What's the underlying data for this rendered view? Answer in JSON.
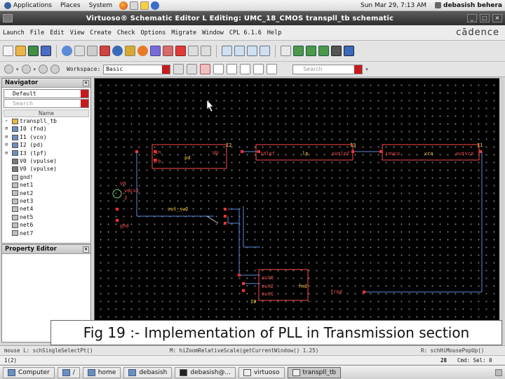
{
  "topbar": {
    "applications": "Applications",
    "places": "Places",
    "system": "System",
    "datetime": "Sun Mar 29,  7:13 AM",
    "user": "debasish behera"
  },
  "window": {
    "title": "Virtuoso® Schematic Editor L Editing: UMC_18_CMOS transpll_tb schematic"
  },
  "menu": {
    "items": [
      "Launch",
      "File",
      "Edit",
      "View",
      "Create",
      "Check",
      "Options",
      "Migrate",
      "Window",
      "CPL 6.1.6",
      "Help"
    ],
    "brand": "cādence"
  },
  "toolbar2": {
    "workspace_label": "Workspace:",
    "workspace_value": "Basic",
    "search_placeholder": "Search"
  },
  "navigator": {
    "title": "Navigator",
    "filter": "Default",
    "search_placeholder": "Search",
    "column": "Name",
    "tree": [
      {
        "label": "transpll_tb",
        "type": "root",
        "exp": "▿"
      },
      {
        "label": "I0 (fnd)",
        "type": "inst",
        "exp": "⊞"
      },
      {
        "label": "I1 (vco)",
        "type": "inst",
        "exp": "⊞"
      },
      {
        "label": "I2 (pd)",
        "type": "inst",
        "exp": "⊞"
      },
      {
        "label": "I3 (lpf)",
        "type": "inst",
        "exp": "⊞"
      },
      {
        "label": "V0 (vpulse)",
        "type": "src",
        "exp": ""
      },
      {
        "label": "V0 (vpulse)",
        "type": "src",
        "exp": ""
      },
      {
        "label": "gnd!",
        "type": "net",
        "exp": ""
      },
      {
        "label": "net1",
        "type": "net",
        "exp": ""
      },
      {
        "label": "net2",
        "type": "net",
        "exp": ""
      },
      {
        "label": "net3",
        "type": "net",
        "exp": ""
      },
      {
        "label": "net4",
        "type": "net",
        "exp": ""
      },
      {
        "label": "net5",
        "type": "net",
        "exp": ""
      },
      {
        "label": "net6",
        "type": "net",
        "exp": ""
      },
      {
        "label": "net7",
        "type": "net",
        "exp": ""
      }
    ]
  },
  "property_editor": {
    "title": "Property Editor"
  },
  "schematic": {
    "pd": {
      "name": "pd",
      "ports": [
        "in",
        "fb"
      ],
      "out": "UU",
      "inst": "I2"
    },
    "lpf": {
      "name": "lp",
      "in": "inlpf",
      "out": "outlpf",
      "inst": "I3"
    },
    "vco": {
      "name": "vco",
      "in": "invco",
      "out": "outvco",
      "inst": "I1"
    },
    "divider": {
      "name": "fnd",
      "ports": [
        "out0",
        "out2",
        "out1"
      ],
      "out": "frnd",
      "inst": "I0"
    },
    "source_labels": [
      "V0",
      "vdc=2",
      "2"
    ],
    "gnd": "gnd",
    "switch_label": "out_sw2"
  },
  "caption": "Fig 19 :- Implementation of PLL in Transmission section",
  "status": {
    "left": "mouse L: schSingleSelectPt()",
    "middle": "M: hiZoomRelativeScale(getCurrentWindow() 1.25)",
    "right": "R: schHiMousePopUp()"
  },
  "cmdline": {
    "prompt": "1(2)",
    "number": "28",
    "cmd_status": "Cmd: Sel: 0"
  },
  "taskbar": [
    {
      "label": "Computer",
      "icon": "folder"
    },
    {
      "label": "/",
      "icon": "folder"
    },
    {
      "label": "home",
      "icon": "folder"
    },
    {
      "label": "debasish",
      "icon": "folder"
    },
    {
      "label": "debasish@...",
      "icon": "term"
    },
    {
      "label": "virtuoso",
      "icon": "app"
    },
    {
      "label": "transpll_tb",
      "icon": "app",
      "active": true
    }
  ]
}
